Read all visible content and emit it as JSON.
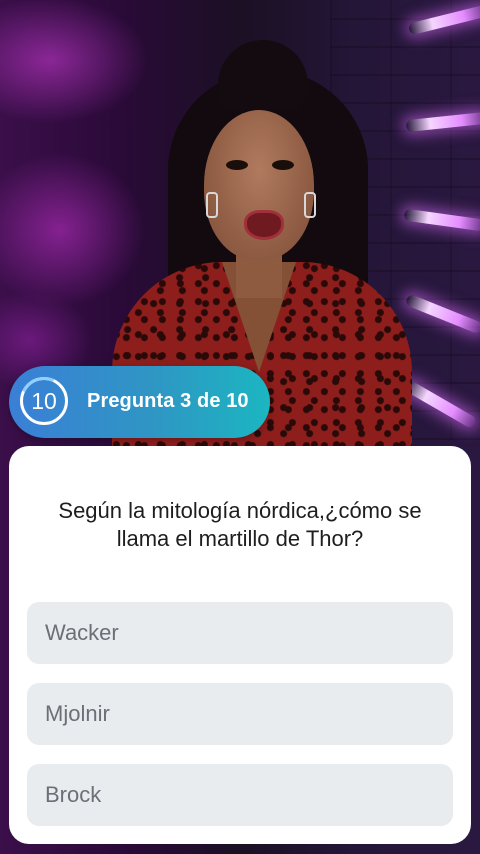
{
  "quiz": {
    "timer_value": "10",
    "progress_label": "Pregunta 3 de 10",
    "question": "Según la mitología nórdica,¿cómo se llama el martillo de Thor?",
    "answers": [
      {
        "label": "Wacker"
      },
      {
        "label": "Mjolnir"
      },
      {
        "label": "Brock"
      }
    ]
  },
  "colors": {
    "counter_gradient_start": "#3a7fd6",
    "counter_gradient_end": "#1bb6c1",
    "card_background": "#ffffff",
    "answer_background": "#e9ecef",
    "answer_text": "#6b7078",
    "question_text": "#1e1e1e"
  },
  "icons": {
    "timer": "countdown-ring-icon"
  }
}
